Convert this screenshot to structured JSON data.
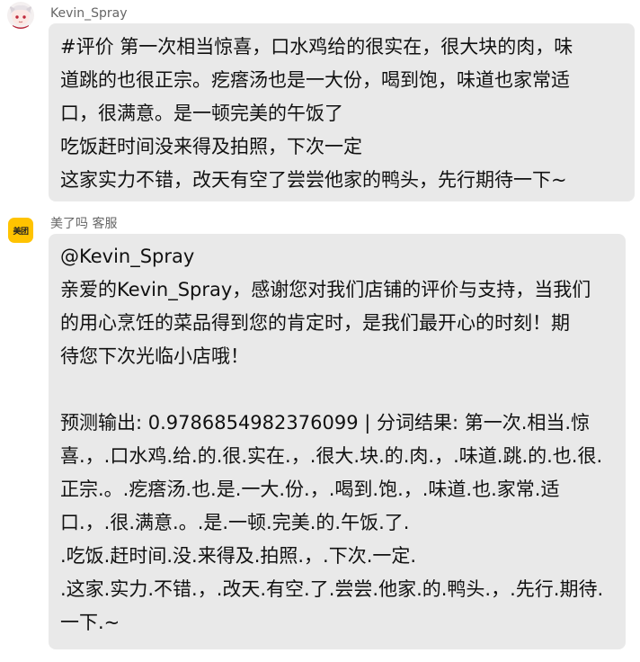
{
  "messages": [
    {
      "sender": "Kevin_Spray",
      "lines": [
        "#评价 第一次相当惊喜，口水鸡给的很实在，很大块的肉，味",
        "道跳的也很正宗。疙瘩汤也是一大份，喝到饱，味道也家常适",
        "口，很满意。是一顿完美的午饭了",
        "吃饭赶时间没来得及拍照，下次一定",
        "这家实力不错，改天有空了尝尝他家的鸭头，先行期待一下~"
      ]
    },
    {
      "sender": "美了吗 客服",
      "avatar_text": "美团",
      "lines": [
        "@Kevin_Spray",
        "亲爱的Kevin_Spray，感谢您对我们店铺的评价与支持，当我们",
        "的用心烹饪的菜品得到您的肯定时，是我们最开心的时刻！期",
        "待您下次光临小店哦！",
        "",
        "预测输出: 0.9786854982376099 | 分词结果: 第一次.相当.惊",
        "喜.，.口水鸡.给.的.很.实在.，.很大.块.的.肉.，.味道.跳.的.也.很.",
        "正宗.。.疙瘩汤.也.是.一大.份.，.喝到.饱.，.味道.也.家常.适",
        "口.，.很.满意.。.是.一顿.完美.的.午饭.了.",
        ".吃饭.赶时间.没.来得及.拍照.，.下次.一定.",
        ".这家.实力.不错.，.改天.有空.了.尝尝.他家.的.鸭头.，.先行.期待.",
        "一下.~"
      ]
    }
  ]
}
